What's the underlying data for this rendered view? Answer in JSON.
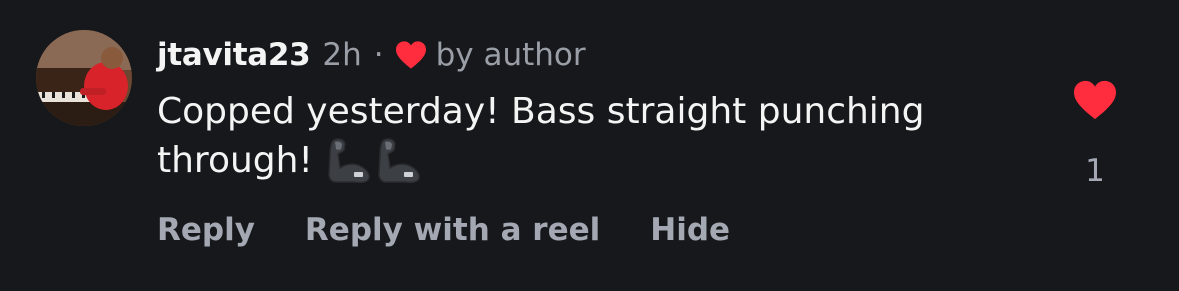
{
  "comment": {
    "username": "jtavita23",
    "time": "2h",
    "separator": "·",
    "author_badge": "by author",
    "text_part1": "Copped yesterday! Bass straight punching through!",
    "emoji_1": "flexed-biceps",
    "emoji_2": "flexed-biceps",
    "like_count": "1",
    "liked": true
  },
  "actions": {
    "reply": "Reply",
    "reply_reel": "Reply with a reel",
    "hide": "Hide"
  },
  "colors": {
    "background": "#16181b",
    "heart": "#ff2d3d",
    "muted": "#9a9ea6"
  },
  "icons": {
    "author_heart": "heart-icon",
    "like": "heart-filled-icon",
    "avatar": "user-avatar"
  }
}
